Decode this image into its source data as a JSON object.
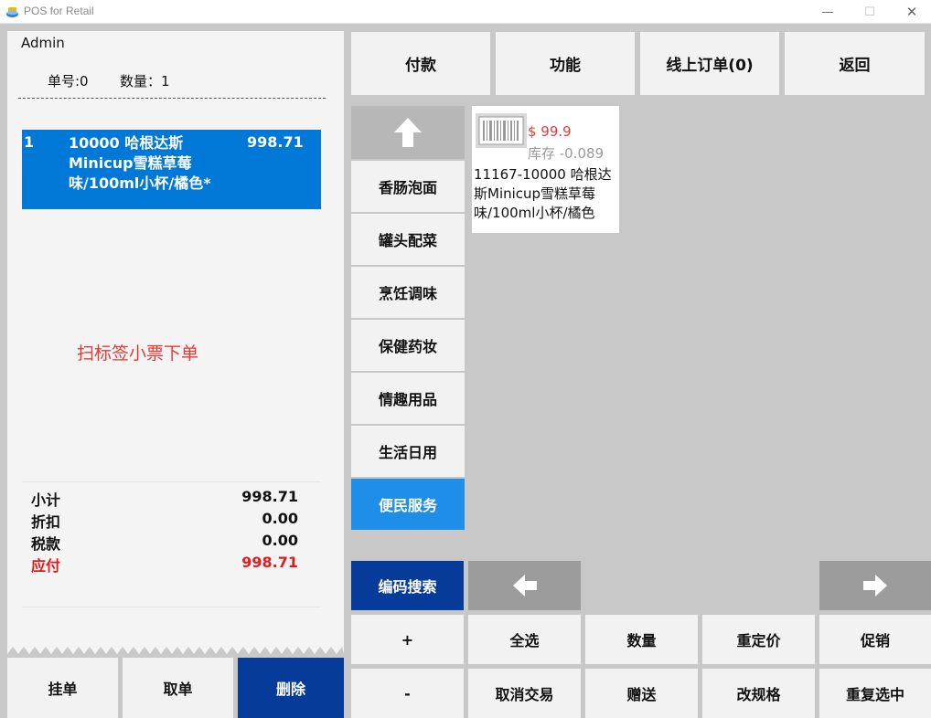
{
  "window": {
    "title": "POS for Retail"
  },
  "receipt": {
    "user": "Admin",
    "order_no": "单号:0",
    "quantity": "数量：1",
    "items": [
      {
        "index": "1",
        "name": "10000 哈根达斯Minicup雪糕草莓味/100ml小杯/橘色*",
        "amount": "998.71"
      }
    ],
    "hint": "扫标签小票下单",
    "totals": {
      "subtotal_label": "小计",
      "subtotal": "998.71",
      "discount_label": "折扣",
      "discount": "0.00",
      "tax_label": "税款",
      "tax": "0.00",
      "payable_label": "应付",
      "payable": "998.71"
    }
  },
  "left_buttons": {
    "hold": "挂单",
    "retrieve": "取单",
    "delete": "删除"
  },
  "top_tabs": {
    "pay": "付款",
    "functions": "功能",
    "online_orders": "线上订单(0)",
    "back": "返回"
  },
  "categories": [
    "香肠泡面",
    "罐头配菜",
    "烹饪调味",
    "保健药妆",
    "情趣用品",
    "生活日用",
    "便民服务"
  ],
  "product": {
    "price": "$ 99.9",
    "stock": "库存 -0.089",
    "name": "11167-10000 哈根达斯Minicup雪糕草莓味/100ml小杯/橘色"
  },
  "controls": {
    "code_search": "编码搜索",
    "plus": "+",
    "select_all": "全选",
    "qty": "数量",
    "reprice": "重定价",
    "promo": "促销",
    "minus": "-",
    "cancel": "取消交易",
    "gift": "赠送",
    "change_spec": "改规格",
    "repeat": "重复选中"
  },
  "colors": {
    "accent_blue": "#0078d7",
    "category_active": "#1e8ee8",
    "dark_blue": "#073b99",
    "alert_red": "#e21b1b",
    "background": "#c8c8c8"
  }
}
